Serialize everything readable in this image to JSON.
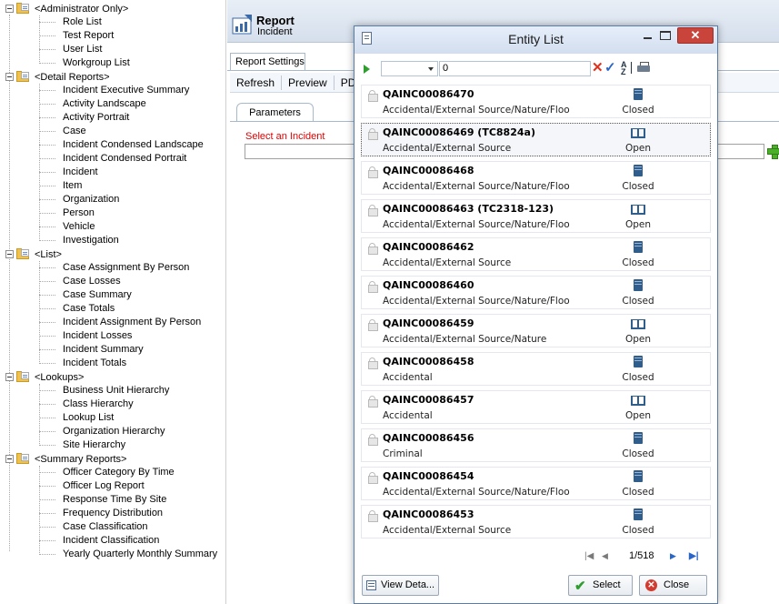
{
  "tree": {
    "groups": [
      {
        "label": "<Administrator Only>",
        "items": [
          "Role List",
          "Test Report",
          "User List",
          "Workgroup List"
        ]
      },
      {
        "label": "<Detail Reports>",
        "items": [
          "Incident Executive Summary",
          "Activity Landscape",
          "Activity Portrait",
          "Case",
          "Incident Condensed Landscape",
          "Incident Condensed Portrait",
          "Incident",
          "Item",
          "Organization",
          "Person",
          "Vehicle",
          "Investigation"
        ]
      },
      {
        "label": "<List>",
        "items": [
          "Case Assignment By Person",
          "Case Losses",
          "Case Summary",
          "Case Totals",
          "Incident Assignment By Person",
          "Incident Losses",
          "Incident Summary",
          "Incident Totals"
        ]
      },
      {
        "label": "<Lookups>",
        "items": [
          "Business Unit Hierarchy",
          "Class Hierarchy",
          "Lookup List",
          "Organization Hierarchy",
          "Site Hierarchy"
        ]
      },
      {
        "label": "<Summary Reports>",
        "items": [
          "Officer Category By Time",
          "Officer Log Report",
          "Response Time By Site",
          "Frequency Distribution",
          "Case Classification",
          "Incident Classification",
          "Yearly Quarterly Monthly Summary"
        ]
      }
    ]
  },
  "report": {
    "title": "Report",
    "subtitle": "Incident",
    "tab_settings": "Report Settings",
    "toolbar": {
      "refresh": "Refresh",
      "preview": "Preview",
      "pdf": "PDF"
    },
    "param_tab": "Parameters",
    "select_label": "Select an Incident",
    "icons": {
      "report": "report-icon",
      "add": "plus-icon"
    }
  },
  "dialog": {
    "title": "Entity List",
    "close_glyph": "✕",
    "filter": {
      "value": "0"
    },
    "items": [
      {
        "id": "QAINC00086470",
        "desc": "Accidental/External Source/Nature/Floo",
        "status": "Closed",
        "icon": "closed-book-icon",
        "selected": false
      },
      {
        "id": "QAINC00086469 (TC8824a)",
        "desc": "Accidental/External Source",
        "status": "Open",
        "icon": "open-book-icon",
        "selected": true
      },
      {
        "id": "QAINC00086468",
        "desc": "Accidental/External Source/Nature/Floo",
        "status": "Closed",
        "icon": "closed-book-icon",
        "selected": false
      },
      {
        "id": "QAINC00086463 (TC2318-123)",
        "desc": "Accidental/External Source/Nature/Floo",
        "status": "Open",
        "icon": "open-book-icon",
        "selected": false
      },
      {
        "id": "QAINC00086462",
        "desc": "Accidental/External Source",
        "status": "Closed",
        "icon": "closed-book-icon",
        "selected": false
      },
      {
        "id": "QAINC00086460",
        "desc": "Accidental/External Source/Nature/Floo",
        "status": "Closed",
        "icon": "closed-book-icon",
        "selected": false
      },
      {
        "id": "QAINC00086459",
        "desc": "Accidental/External Source/Nature",
        "status": "Open",
        "icon": "open-book-icon",
        "selected": false
      },
      {
        "id": "QAINC00086458",
        "desc": "Accidental",
        "status": "Closed",
        "icon": "closed-book-icon",
        "selected": false
      },
      {
        "id": "QAINC00086457",
        "desc": "Accidental",
        "status": "Open",
        "icon": "open-book-icon",
        "selected": false
      },
      {
        "id": "QAINC00086456",
        "desc": "Criminal",
        "status": "Closed",
        "icon": "closed-book-icon",
        "selected": false
      },
      {
        "id": "QAINC00086454",
        "desc": "Accidental/External Source/Nature/Floo",
        "status": "Closed",
        "icon": "closed-book-icon",
        "selected": false
      },
      {
        "id": "QAINC00086453",
        "desc": "Accidental/External Source",
        "status": "Closed",
        "icon": "closed-book-icon",
        "selected": false
      }
    ],
    "pager": {
      "current": 1,
      "total": 518,
      "text": "1/518"
    },
    "buttons": {
      "view": "View Deta...",
      "select": "Select",
      "close": "Close"
    }
  }
}
